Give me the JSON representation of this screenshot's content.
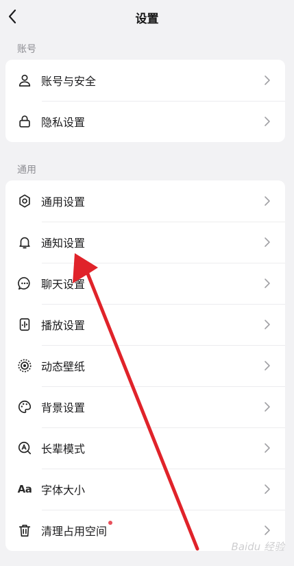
{
  "header": {
    "title": "设置"
  },
  "sections": [
    {
      "label": "账号",
      "items": [
        {
          "label": "账号与安全",
          "icon": "user-icon"
        },
        {
          "label": "隐私设置",
          "icon": "lock-icon"
        }
      ]
    },
    {
      "label": "通用",
      "items": [
        {
          "label": "通用设置",
          "icon": "gear-icon"
        },
        {
          "label": "通知设置",
          "icon": "bell-icon"
        },
        {
          "label": "聊天设置",
          "icon": "chat-bubble-icon"
        },
        {
          "label": "播放设置",
          "icon": "play-settings-icon"
        },
        {
          "label": "动态壁纸",
          "icon": "live-wallpaper-icon"
        },
        {
          "label": "背景设置",
          "icon": "palette-icon"
        },
        {
          "label": "长辈模式",
          "icon": "elder-mode-icon"
        },
        {
          "label": "字体大小",
          "icon": "font-size-icon",
          "icon_text": "Aa"
        },
        {
          "label": "清理占用空间",
          "icon": "trash-icon",
          "badge": true
        }
      ]
    }
  ],
  "colors": {
    "background": "#f2f2f4",
    "card": "#ffffff",
    "annotation_arrow": "#e0232a",
    "badge_dot": "#e8505b"
  },
  "watermark": "Baidu 经验"
}
